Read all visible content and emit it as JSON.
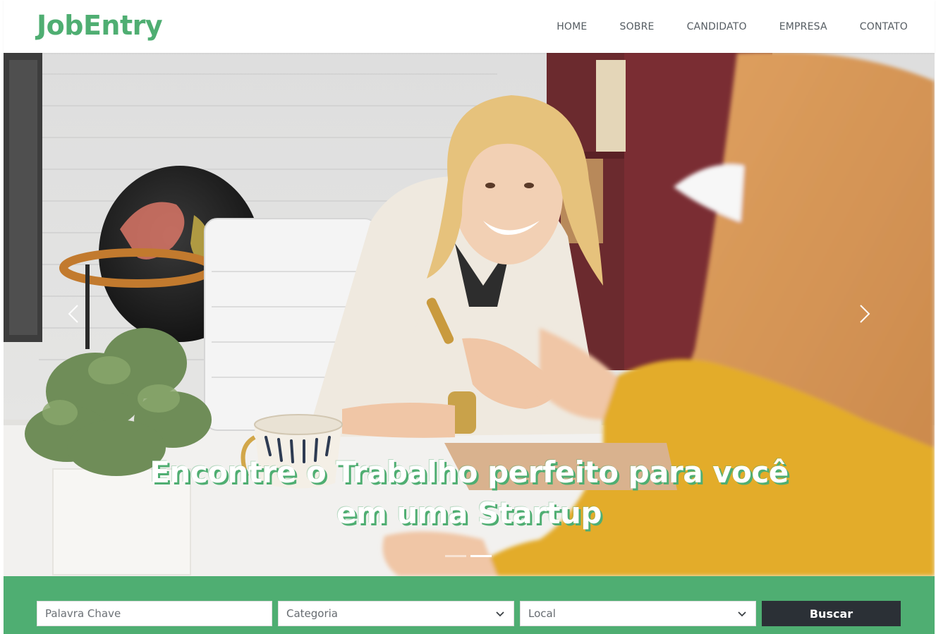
{
  "brand": {
    "name": "JobEntry",
    "color": "#4fae72"
  },
  "nav": {
    "items": [
      {
        "label": "HOME"
      },
      {
        "label": "SOBRE"
      },
      {
        "label": "CANDIDATO"
      },
      {
        "label": "EMPRESA"
      },
      {
        "label": "CONTATO"
      }
    ]
  },
  "hero": {
    "headline_line1": "Encontre o Trabalho perfeito para você",
    "headline_line2": "em uma Startup",
    "slide_count": 2,
    "active_slide": 2,
    "prev_icon": "chevron-left-icon",
    "next_icon": "chevron-right-icon"
  },
  "search": {
    "keyword_placeholder": "Palavra Chave",
    "category_selected": "Categoria",
    "location_selected": "Local",
    "button_label": "Buscar",
    "bar_color": "#4fae72",
    "button_color": "#2b3036"
  }
}
